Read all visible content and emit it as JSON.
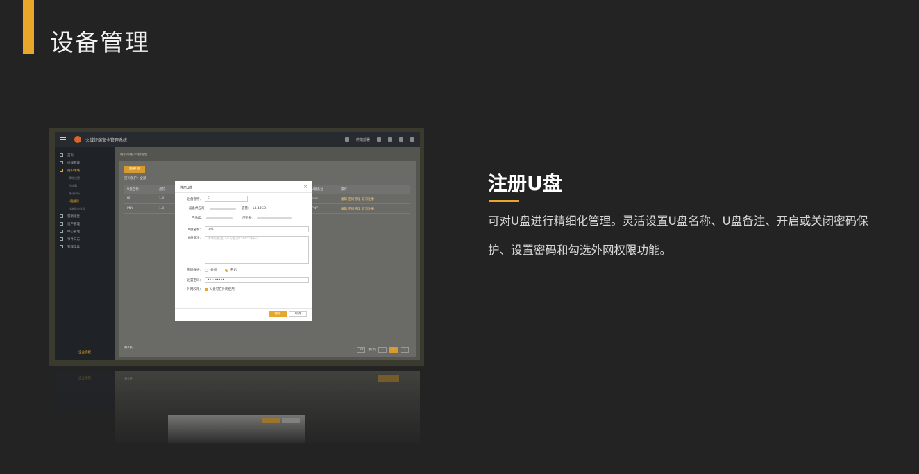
{
  "slide": {
    "title": "设备管理",
    "feature_title": "注册U盘",
    "feature_desc": "可对U盘进行精细化管理。灵活设置U盘名称、U盘备注、开启或关闭密码保护、设置密码和勾选外网权限功能。",
    "accent_color": "#e8a72b",
    "background_color": "#232323"
  },
  "app": {
    "name": "火绒终端安全管理系统",
    "topbar_right_label": "终端部署",
    "breadcrumb": "防护策略 / U盘管理",
    "sidebar": {
      "items": [
        {
          "label": "首页",
          "icon": "home-icon"
        },
        {
          "label": "终端管理",
          "icon": "monitor-icon"
        },
        {
          "label": "防护策略",
          "icon": "shield-icon",
          "active": true
        },
        {
          "label": "漏洞修复",
          "icon": "patch-icon"
        },
        {
          "label": "资产管理",
          "icon": "layers-icon"
        },
        {
          "label": "中心管理",
          "icon": "server-icon"
        },
        {
          "label": "事件日志",
          "icon": "log-icon"
        },
        {
          "label": "管理工具",
          "icon": "tool-icon"
        }
      ],
      "sub_items": [
        "策略设置",
        "防病毒",
        "统计分析",
        "U盘管理",
        "终端动态认证"
      ],
      "footer": "企业授权"
    },
    "register_button": "注册U盘",
    "filter_label": "密码保护：",
    "filter_value": "全部",
    "table": {
      "headers": [
        "U盘名称",
        "盘符",
        "U盘备注",
        "操作"
      ],
      "rows": [
        {
          "name": "t0",
          "drive": "1.0",
          "note": "test",
          "actions": "编辑  密码管理  取消注册"
        },
        {
          "name": "PNY",
          "drive": "1.0",
          "note": "PNY",
          "actions": "编辑  密码管理  取消注册"
        }
      ]
    },
    "total": "共2条",
    "pager": {
      "size": "10",
      "size_suffix": "条/页",
      "current": "1"
    }
  },
  "modal": {
    "title": "注册U盘",
    "close": "×",
    "device_label": "设备盘符：",
    "device_value": "E",
    "vendor_label": "设备供应商：",
    "capacity_label": "容量：",
    "capacity_value": "14.44GB",
    "product_label": "产品ID：",
    "serial_label": "序列号：",
    "name_label": "U盘名称：",
    "name_value": "test",
    "note_label": "U盘备注：",
    "note_placeholder": "请填写备注（不可超过1500个字符）",
    "pwd_protect_label": "密码保护：",
    "pwd_off": "关闭",
    "pwd_on": "开启",
    "pwd_label": "设置密码：",
    "pwd_value": "•••••••••",
    "ext_label": "外网权限：",
    "ext_option": "U盘可在外网使用",
    "ok_button": "保存",
    "cancel_button": "取消"
  }
}
